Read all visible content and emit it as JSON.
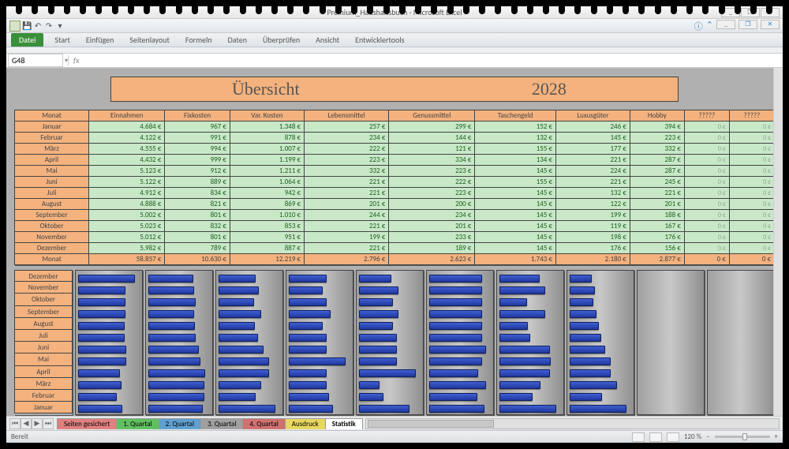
{
  "app": {
    "title_center": "Premium_Haushaltsbuch - Microsoft Excel",
    "window_minimize": "_",
    "window_restore": "❐",
    "window_close": "✕"
  },
  "ribbon": {
    "file_label": "Datei",
    "tabs": [
      "Start",
      "Einfügen",
      "Seitenlayout",
      "Formeln",
      "Daten",
      "Überprüfen",
      "Ansicht",
      "Entwicklertools"
    ]
  },
  "formula": {
    "name_box": "G48",
    "fx_label": "fx",
    "formula_text": ""
  },
  "sheet_title": {
    "left": "Übersicht",
    "right": "2028"
  },
  "columns": [
    "Monat",
    "Einnahmen",
    "Fixkosten",
    "Var. Kosten",
    "Lebensmittel",
    "Genussmittel",
    "Taschengeld",
    "Luxusgüter",
    "Hobby",
    "?????",
    "?????"
  ],
  "months": [
    "Januar",
    "Februar",
    "März",
    "April",
    "Mai",
    "Juni",
    "Juli",
    "August",
    "September",
    "Oktober",
    "November",
    "Dezember"
  ],
  "rows": [
    {
      "m": "Januar",
      "v": [
        "4.684 €",
        "967 €",
        "1.348 €",
        "257 €",
        "299 €",
        "152 €",
        "246 €",
        "394 €",
        "0 €",
        "0 €"
      ]
    },
    {
      "m": "Februar",
      "v": [
        "4.122 €",
        "991 €",
        "878 €",
        "234 €",
        "144 €",
        "132 €",
        "145 €",
        "223 €",
        "0 €",
        "0 €"
      ]
    },
    {
      "m": "März",
      "v": [
        "4.555 €",
        "994 €",
        "1.007 €",
        "222 €",
        "121 €",
        "155 €",
        "177 €",
        "332 €",
        "0 €",
        "0 €"
      ]
    },
    {
      "m": "April",
      "v": [
        "4.432 €",
        "999 €",
        "1.199 €",
        "223 €",
        "334 €",
        "134 €",
        "221 €",
        "287 €",
        "0 €",
        "0 €"
      ]
    },
    {
      "m": "Mai",
      "v": [
        "5.123 €",
        "912 €",
        "1.211 €",
        "332 €",
        "223 €",
        "145 €",
        "224 €",
        "287 €",
        "0 €",
        "0 €"
      ]
    },
    {
      "m": "Juni",
      "v": [
        "5.122 €",
        "889 €",
        "1.064 €",
        "221 €",
        "222 €",
        "155 €",
        "221 €",
        "245 €",
        "0 €",
        "0 €"
      ]
    },
    {
      "m": "Juli",
      "v": [
        "4.912 €",
        "834 €",
        "942 €",
        "221 €",
        "223 €",
        "145 €",
        "132 €",
        "221 €",
        "0 €",
        "0 €"
      ]
    },
    {
      "m": "August",
      "v": [
        "4.888 €",
        "821 €",
        "869 €",
        "201 €",
        "200 €",
        "145 €",
        "122 €",
        "201 €",
        "0 €",
        "0 €"
      ]
    },
    {
      "m": "September",
      "v": [
        "5.002 €",
        "801 €",
        "1.010 €",
        "244 €",
        "234 €",
        "145 €",
        "199 €",
        "188 €",
        "0 €",
        "0 €"
      ]
    },
    {
      "m": "Oktober",
      "v": [
        "5.023 €",
        "832 €",
        "853 €",
        "221 €",
        "201 €",
        "145 €",
        "119 €",
        "167 €",
        "0 €",
        "0 €"
      ]
    },
    {
      "m": "November",
      "v": [
        "5.012 €",
        "801 €",
        "951 €",
        "199 €",
        "233 €",
        "145 €",
        "198 €",
        "176 €",
        "0 €",
        "0 €"
      ]
    },
    {
      "m": "Dezember",
      "v": [
        "5.982 €",
        "789 €",
        "887 €",
        "221 €",
        "189 €",
        "145 €",
        "176 €",
        "156 €",
        "0 €",
        "0 €"
      ]
    }
  ],
  "total_row": {
    "m": "Monat",
    "v": [
      "58.857 €",
      "10.630 €",
      "12.219 €",
      "2.796 €",
      "2.623 €",
      "1.743 €",
      "2.180 €",
      "2.877 €",
      "0 €",
      "0 €"
    ]
  },
  "chart_data": {
    "type": "bar",
    "orientation": "horizontal",
    "categories_reversed": [
      "Dezember",
      "November",
      "Oktober",
      "September",
      "August",
      "Juli",
      "Juni",
      "Mai",
      "April",
      "März",
      "Februar",
      "Januar"
    ],
    "series": [
      {
        "name": "Einnahmen",
        "max": 5982,
        "values": [
          5982,
          5012,
          5023,
          5002,
          4888,
          4912,
          5122,
          5123,
          4432,
          4555,
          4122,
          4684
        ]
      },
      {
        "name": "Fixkosten",
        "max": 999,
        "values": [
          789,
          801,
          832,
          801,
          821,
          834,
          889,
          912,
          999,
          994,
          991,
          967
        ]
      },
      {
        "name": "Var. Kosten",
        "max": 1348,
        "values": [
          887,
          951,
          853,
          1010,
          869,
          942,
          1064,
          1211,
          1199,
          1007,
          878,
          1348
        ]
      },
      {
        "name": "Lebensmittel",
        "max": 332,
        "values": [
          221,
          199,
          221,
          244,
          201,
          221,
          221,
          332,
          223,
          222,
          234,
          257
        ]
      },
      {
        "name": "Genussmittel",
        "max": 334,
        "values": [
          189,
          233,
          201,
          234,
          200,
          223,
          222,
          223,
          334,
          121,
          144,
          299
        ]
      },
      {
        "name": "Taschengeld",
        "max": 155,
        "values": [
          145,
          145,
          145,
          145,
          145,
          145,
          155,
          145,
          134,
          155,
          132,
          152
        ]
      },
      {
        "name": "Luxusgüter",
        "max": 246,
        "values": [
          176,
          198,
          119,
          199,
          122,
          132,
          221,
          224,
          221,
          177,
          145,
          246
        ]
      },
      {
        "name": "Hobby",
        "max": 394,
        "values": [
          156,
          176,
          167,
          188,
          201,
          221,
          245,
          287,
          287,
          332,
          223,
          394
        ]
      },
      {
        "name": "?????",
        "max": 1,
        "values": [
          0,
          0,
          0,
          0,
          0,
          0,
          0,
          0,
          0,
          0,
          0,
          0
        ]
      },
      {
        "name": "?????",
        "max": 1,
        "values": [
          0,
          0,
          0,
          0,
          0,
          0,
          0,
          0,
          0,
          0,
          0,
          0
        ]
      }
    ]
  },
  "sheet_tabs": [
    {
      "label": "Seiten gesichert",
      "color": "#e08080"
    },
    {
      "label": "1. Quartal",
      "color": "#60c060"
    },
    {
      "label": "2. Quartal",
      "color": "#60a0d0"
    },
    {
      "label": "3. Quartal",
      "color": "#a0a0a0"
    },
    {
      "label": "4. Quartal",
      "color": "#d07070"
    },
    {
      "label": "Ausdruck",
      "color": "#e8d860"
    },
    {
      "label": "Statistik",
      "color": "#ffffff",
      "active": true
    }
  ],
  "status": {
    "left": "Bereit",
    "zoom": "120 %",
    "zoom_minus": "−",
    "zoom_plus": "+"
  }
}
